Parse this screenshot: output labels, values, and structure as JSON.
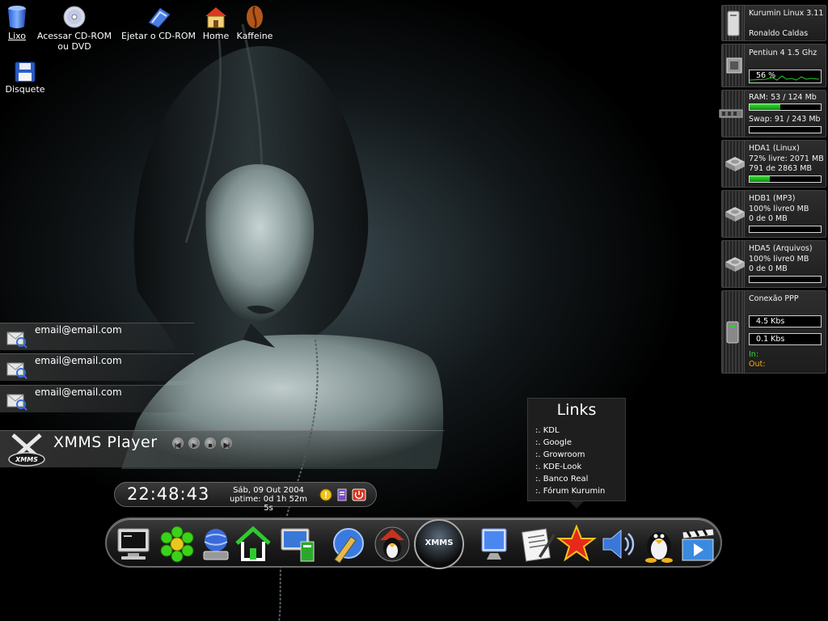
{
  "desktop": {
    "icons": [
      {
        "label": "Lixo",
        "icon": "trash-icon"
      },
      {
        "label": "Acessar CD-ROM",
        "label2": "ou DVD",
        "icon": "cdrom-icon"
      },
      {
        "label": "Ejetar o CD-ROM",
        "icon": "eject-cdrom-icon"
      },
      {
        "label": "Home",
        "icon": "home-folder-icon"
      },
      {
        "label": "Kaffeine",
        "icon": "kaffeine-icon"
      },
      {
        "label": "Disquete",
        "icon": "floppy-icon"
      }
    ]
  },
  "monitor": {
    "system": {
      "title": "Kurumin Linux 3.11",
      "user": "Ronaldo Caldas"
    },
    "cpu": {
      "label": "Pentiun 4 1.5 Ghz",
      "usage_text": "56 %",
      "usage": 0.56
    },
    "ram": {
      "label": "RAM: 53 / 124 Mb",
      "fill": 0.43,
      "swap_label": "Swap: 91 / 243 Mb",
      "swap_fill": 0.0
    },
    "disks": [
      {
        "title": "HDA1 (Linux)",
        "free": "72% livre: 2071 MB",
        "used": "791 de 2863 MB",
        "fill": 0.28
      },
      {
        "title": "HDB1 (MP3)",
        "free": "100% livre0 MB",
        "used": "0 de 0 MB",
        "fill": 0.0
      },
      {
        "title": "HDA5 (Arquivos)",
        "free": "100% livre0 MB",
        "used": "0 de 0 MB",
        "fill": 0.0
      }
    ],
    "net": {
      "title": "Conexão PPP",
      "in_rate": "4.5 Kbs",
      "out_rate": "0.1 Kbs",
      "in_label": "In:",
      "out_label": "Out:",
      "in_color": "#33dd33",
      "out_color": "#ffaa00"
    }
  },
  "mail": {
    "accounts": [
      "email@email.com",
      "email@email.com",
      "email@email.com"
    ]
  },
  "xmms": {
    "title": "XMMS Player",
    "logo_text": "XMMS"
  },
  "clock": {
    "time": "22:48:43",
    "date": "Sáb, 09 Out  2004",
    "uptime": "uptime: 0d 1h 52m 5s"
  },
  "links": {
    "title": "Links",
    "items": [
      ":. KDL",
      ":. Google",
      ":. Growroom",
      ":. KDE-Look",
      ":. Banco Real",
      ":. Fórum Kurumin"
    ]
  },
  "dock": {
    "items": [
      "terminal-icon",
      "icq-icon",
      "network-drive-icon",
      "home-icon",
      "monitor-network-icon",
      "web-browser-pen-icon",
      "tux-mascot-icon",
      "xmms-icon",
      "display-settings-icon",
      "text-editor-icon",
      "star-apps-icon",
      "volume-icon",
      "tux-icon",
      "video-player-icon"
    ],
    "xmms_label": "XMMS"
  }
}
